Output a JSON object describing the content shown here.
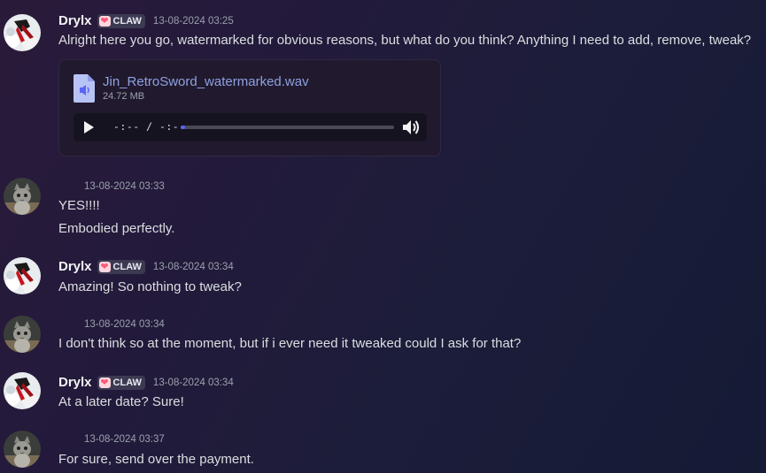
{
  "messages": [
    {
      "username": "Drylx",
      "tag": "CLAW",
      "timestamp": "13-08-2024 03:25",
      "lines": [
        "Alright here you go, watermarked for obvious reasons, but what do you think? Anything I need to add, remove, tweak?"
      ],
      "attachment": {
        "filename": "Jin_RetroSword_watermarked.wav",
        "size": "24.72 MB",
        "time_display": "-:-- / -:--",
        "progress": 0.02
      }
    },
    {
      "timestamp": "13-08-2024 03:33",
      "lines": [
        "YES!!!!",
        "Embodied perfectly."
      ]
    },
    {
      "username": "Drylx",
      "tag": "CLAW",
      "timestamp": "13-08-2024 03:34",
      "lines": [
        "Amazing! So nothing to tweak?"
      ]
    },
    {
      "timestamp": "13-08-2024 03:34",
      "lines": [
        "I don't think so at the moment, but if i ever need it tweaked could I ask for that?"
      ]
    },
    {
      "username": "Drylx",
      "tag": "CLAW",
      "timestamp": "13-08-2024 03:34",
      "lines": [
        "At a later date? Sure!"
      ]
    },
    {
      "timestamp": "13-08-2024 03:37",
      "lines": [
        "For sure, send over the payment."
      ]
    }
  ],
  "icons": {
    "audio_file": "audio-file-icon",
    "play": "play-icon",
    "volume": "volume-icon",
    "tag_badge": "heart-icon"
  },
  "colors": {
    "link": "#8ea1e1",
    "progress": "#5865f2",
    "tag_bg": "#3c3a52"
  }
}
